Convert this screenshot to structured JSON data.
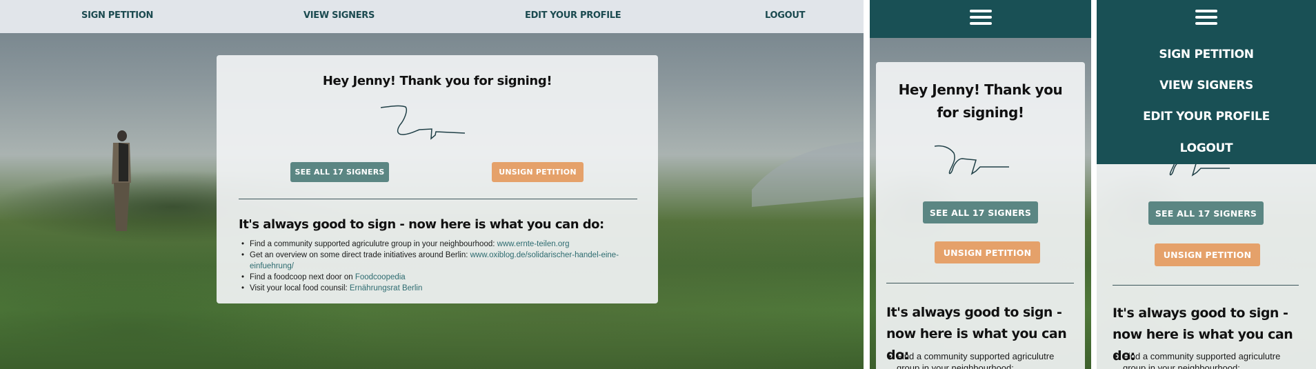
{
  "nav": {
    "sign_petition": "SIGN PETITION",
    "view_signers": "VIEW SIGNERS",
    "edit_profile": "EDIT YOUR PROFILE",
    "logout": "LOGOUT"
  },
  "thanks": {
    "heading": "Hey Jenny! Thank you for signing!",
    "see_all_button": "SEE ALL 17 SIGNERS",
    "unsign_button": "UNSIGN PETITION"
  },
  "info": {
    "heading": "It's always good to sign - now here is what you can do:",
    "items": [
      {
        "text": "Find a community supported agriculutre group in your neighbourhood: ",
        "link": "www.ernte-teilen.org"
      },
      {
        "text": "Get an overview on some direct trade initiatives around Berlin: ",
        "link": "www.oxiblog.de/solidarischer-handel-eine-einfuehrung/"
      },
      {
        "text": "Find a foodcoop next door on ",
        "link": "Foodcoopedia"
      },
      {
        "text": "Visit your local food counsil: ",
        "link": "Ernährungsrat Berlin"
      }
    ],
    "mobile_partial_item": "Find a community supported agriculutre group in your neighbourhood:"
  },
  "icons": {
    "menu": "hamburger-menu-icon",
    "signature": "signature-image"
  },
  "colors": {
    "nav_bg": "#e1e5ea",
    "nav_text": "#1b4a50",
    "mobile_header": "#195055",
    "signers_button": "#5b8683",
    "unsign_button": "#e5a16a",
    "link": "#2d6b70"
  }
}
